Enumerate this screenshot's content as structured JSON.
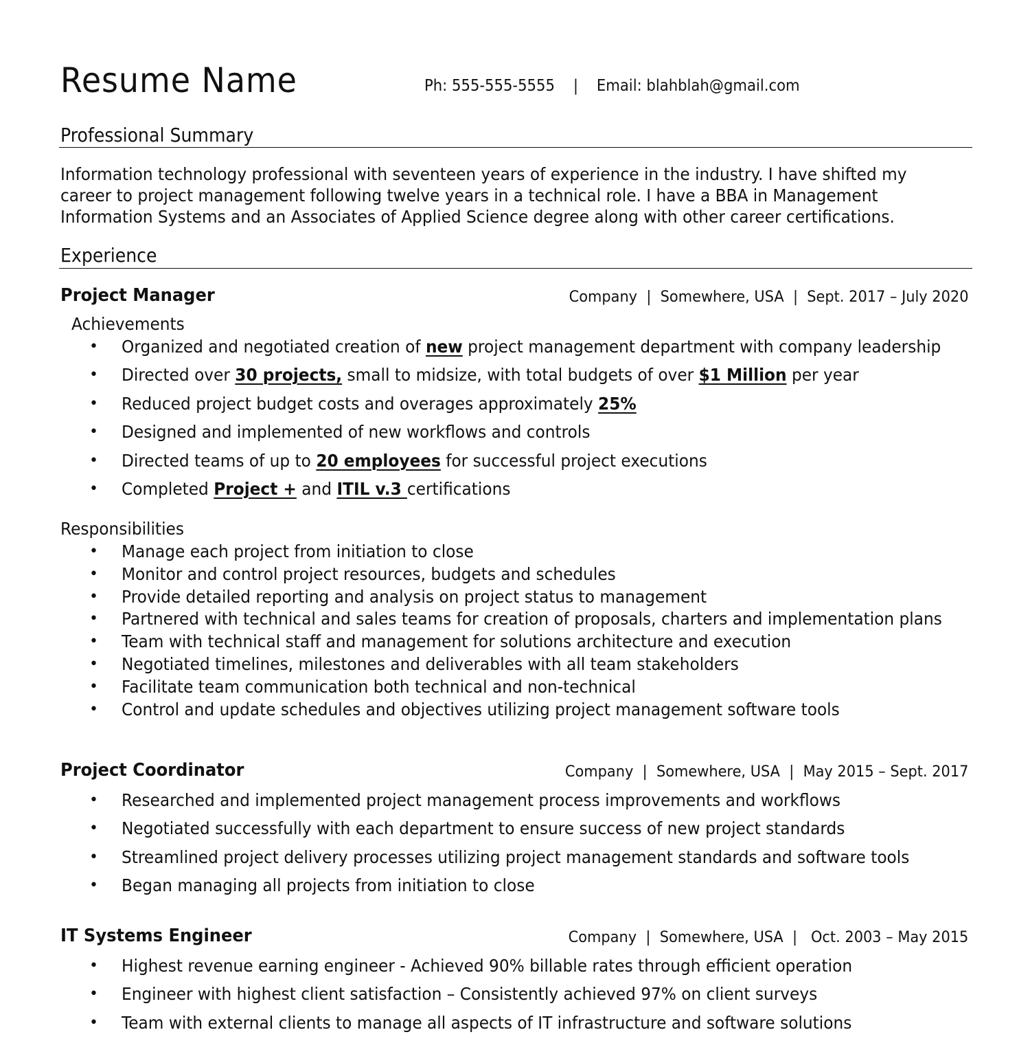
{
  "header": {
    "name": "Resume Name",
    "contact": "Ph: 555-555-5555    |    Email: blahblah@gmail.com"
  },
  "summary": {
    "title": "Professional Summary",
    "text": "Information technology professional with seventeen years of experience in the industry. I have shifted my career to project management following twelve years in a technical role. I have a BBA in Management Information Systems and an Associates of Applied Science degree along with other career certifications."
  },
  "experience": {
    "title": "Experience",
    "jobs": [
      {
        "title": "Project Manager",
        "meta": "Company  |  Somewhere, USA  |  Sept. 2017 – July 2020",
        "achievements_label": "Achievements",
        "achievements": [
          {
            "pre": "Organized and negotiated creation of ",
            "em": "new",
            "mid": " project management department with company leadership",
            "em2": "",
            "post": ""
          },
          {
            "pre": "Directed over ",
            "em": "30 projects,",
            "mid": " small to midsize, with total budgets of over ",
            "em2": "$1 Million",
            "post": " per year"
          },
          {
            "pre": "Reduced project budget costs and overages approximately ",
            "em": "25%",
            "mid": "",
            "em2": "",
            "post": ""
          },
          {
            "pre": "Designed and implemented of new workflows and controls",
            "em": "",
            "mid": "",
            "em2": "",
            "post": ""
          },
          {
            "pre": "Directed teams of up to ",
            "em": "20 employees",
            "mid": " for successful project executions",
            "em2": "",
            "post": ""
          },
          {
            "pre": "Completed ",
            "em": "Project +",
            "mid": " and ",
            "em2": "ITIL v.3 ",
            "post": "certifications"
          }
        ],
        "responsibilities_label": "Responsibilities",
        "responsibilities": [
          "Manage each project from initiation to close",
          "Monitor and control project resources, budgets and schedules",
          "Provide detailed reporting and analysis on project status to management",
          "Partnered with technical and sales teams for creation of proposals, charters and implementation plans",
          "Team with technical staff and management for solutions architecture and execution",
          "Negotiated timelines, milestones and deliverables with all team stakeholders",
          "Facilitate team communication both technical and non-technical",
          "Control and update schedules and objectives utilizing project management software tools"
        ]
      },
      {
        "title": "Project Coordinator",
        "meta": "Company  |  Somewhere, USA  |  May 2015 – Sept. 2017",
        "bullets": [
          "Researched and implemented project management process improvements and workflows",
          "Negotiated successfully with each department to ensure success of new project standards",
          "Streamlined project delivery processes utilizing project management standards and software tools",
          "Began managing all projects from initiation to close"
        ]
      },
      {
        "title": "IT Systems Engineer",
        "meta": "Company  |  Somewhere, USA  |   Oct. 2003 – May 2015",
        "bullets": [
          "Highest revenue earning engineer - Achieved 90% billable rates through efficient operation",
          "Engineer with highest client satisfaction – Consistently achieved 97% on client surveys",
          "Team with external clients to manage all aspects of IT infrastructure and software solutions"
        ]
      }
    ]
  }
}
